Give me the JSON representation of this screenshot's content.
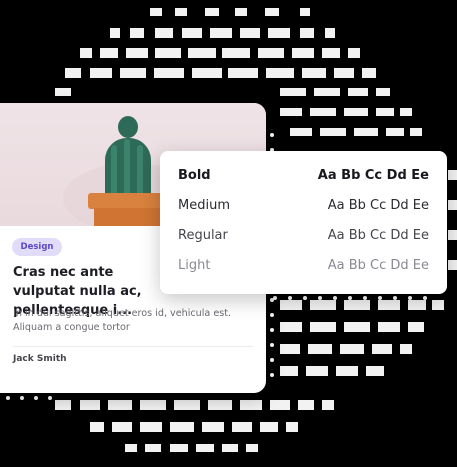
{
  "card": {
    "tag": "Design",
    "title": "Cras nec ante vulputat nulla ac, pellentesque i...",
    "description": "In in dui sagittis, aliquet eros id, vehicula est. Aliquam a congue tortor",
    "author": "Jack Smith"
  },
  "typography": {
    "rows": [
      {
        "weight": "Bold",
        "sample": "Aa Bb Cc Dd Ee"
      },
      {
        "weight": "Medium",
        "sample": "Aa Bb Cc Dd Ee"
      },
      {
        "weight": "Regular",
        "sample": "Aa Bb Cc Dd Ee"
      },
      {
        "weight": "Light",
        "sample": "Aa Bb Cc Dd Ee"
      }
    ]
  },
  "colors": {
    "background": "#000000",
    "pattern": "#ffffff",
    "tag_bg": "#e2dcfb",
    "tag_text": "#5a48c8",
    "pot": "#d9813e",
    "cactus": "#2e6a58"
  }
}
